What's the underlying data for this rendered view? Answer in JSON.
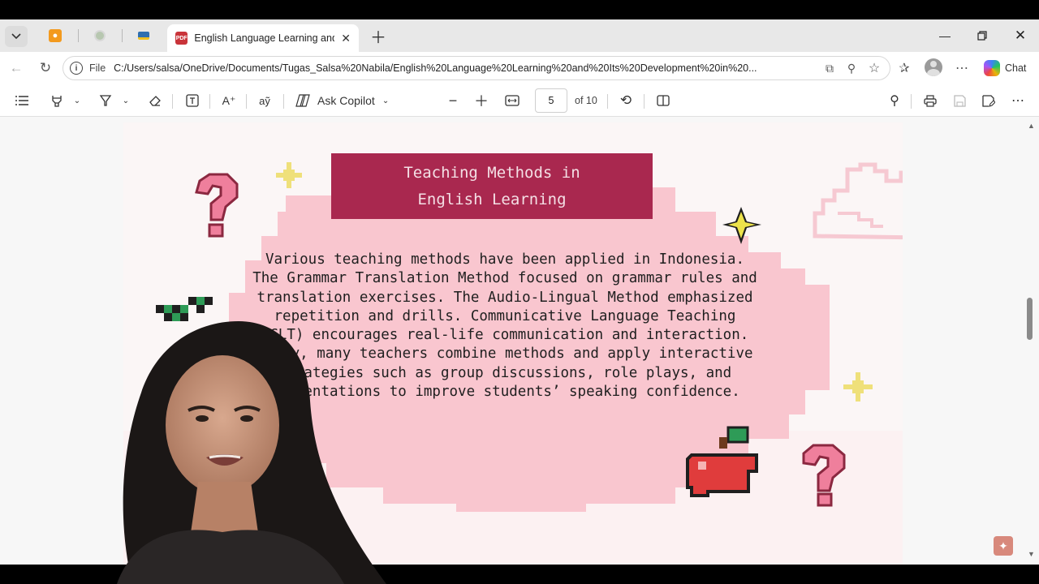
{
  "browser": {
    "active_tab_title": "English Language Learning and Its",
    "address_prefix": "File",
    "url": "C:/Users/salsa/OneDrive/Documents/Tugas_Salsa%20Nabila/English%20Language%20Learning%20and%20Its%20Development%20in%20...",
    "chat_label": "Chat"
  },
  "pdf_toolbar": {
    "ask_copilot_label": "Ask Copilot",
    "current_page": "5",
    "total_pages_label": "of 10"
  },
  "slide": {
    "title": "Teaching Methods in\nEnglish Learning",
    "body": "Various teaching methods have been applied in Indonesia. The Grammar Translation Method focused on grammar rules and translation exercises. The Audio-Lingual Method emphasized repetition and drills. Communicative Language Teaching (CLT) encourages real-life communication and interaction. Today, many teachers combine methods and apply interactive strategies such as group discussions, role plays, and presentations to improve students’ speaking confidence.",
    "colors": {
      "title_bg": "#a9284f",
      "blob": "#f9c6cf",
      "accent": "#e8899a"
    }
  }
}
